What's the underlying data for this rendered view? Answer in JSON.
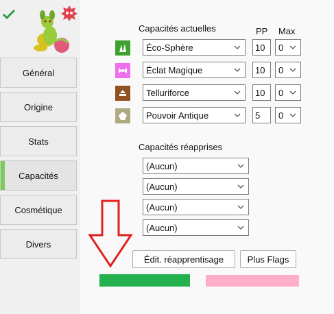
{
  "tabs": [
    "Général",
    "Origine",
    "Stats",
    "Capacités",
    "Cosmétique",
    "Divers"
  ],
  "active_tab": "Capacités",
  "moves": {
    "header": "Capacités actuelles",
    "pp_header": "PP",
    "max_header": "Max",
    "rows": [
      {
        "name": "Éco-Sphère",
        "type": "grass",
        "type_color": "#3fa12f",
        "pp": "10",
        "max": "0"
      },
      {
        "name": "Éclat Magique",
        "type": "fairy",
        "type_color": "#ef70ef",
        "pp": "10",
        "max": "0"
      },
      {
        "name": "Telluriforce",
        "type": "ground",
        "type_color": "#915121",
        "pp": "10",
        "max": "0"
      },
      {
        "name": "Pouvoir Antique",
        "type": "rock",
        "type_color": "#afa981",
        "pp": "5",
        "max": "0"
      }
    ]
  },
  "relearn": {
    "header": "Capacités réapprises",
    "options": [
      "(Aucun)",
      "(Aucun)",
      "(Aucun)",
      "(Aucun)"
    ]
  },
  "buttons": {
    "relearn_edit": "Édit. réapprentisage",
    "flags": "Plus Flags"
  },
  "colors": {
    "legal_bar": "#22b14c",
    "shiny_bar": "#ffaec9",
    "overlay_arrow": "#e02020",
    "active_tab_marker": "#7ccc5c"
  }
}
